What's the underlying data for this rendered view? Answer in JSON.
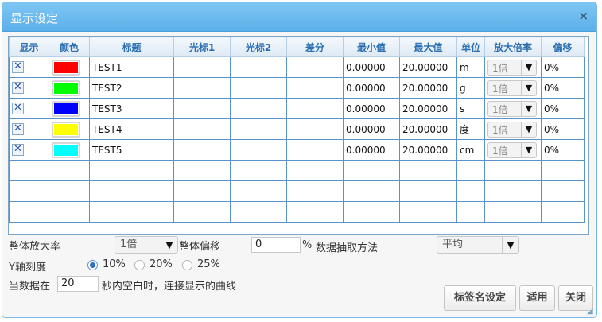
{
  "window": {
    "title": "显示设定",
    "close_symbol": "×"
  },
  "table": {
    "headers": [
      "显示",
      "颜色",
      "标题",
      "光标1",
      "光标2",
      "差分",
      "最小值",
      "最大值",
      "单位",
      "放大倍率",
      "偏移"
    ],
    "rows": [
      {
        "checked": true,
        "color": "#ff0000",
        "title": "TEST1",
        "cursor1": "",
        "cursor2": "",
        "diff": "",
        "min": "0.00000",
        "max": "20.00000",
        "unit": "m",
        "zoom": "1倍",
        "offset": "0%"
      },
      {
        "checked": true,
        "color": "#00ff00",
        "title": "TEST2",
        "cursor1": "",
        "cursor2": "",
        "diff": "",
        "min": "0.00000",
        "max": "20.00000",
        "unit": "g",
        "zoom": "1倍",
        "offset": "0%"
      },
      {
        "checked": true,
        "color": "#0000ff",
        "title": "TEST3",
        "cursor1": "",
        "cursor2": "",
        "diff": "",
        "min": "0.00000",
        "max": "20.00000",
        "unit": "s",
        "zoom": "1倍",
        "offset": "0%"
      },
      {
        "checked": true,
        "color": "#ffff00",
        "title": "TEST4",
        "cursor1": "",
        "cursor2": "",
        "diff": "",
        "min": "0.00000",
        "max": "20.00000",
        "unit": "度",
        "zoom": "1倍",
        "offset": "0%"
      },
      {
        "checked": true,
        "color": "#00ffff",
        "title": "TEST5",
        "cursor1": "",
        "cursor2": "",
        "diff": "",
        "min": "0.00000",
        "max": "20.00000",
        "unit": "cm",
        "zoom": "1倍",
        "offset": "0%"
      }
    ],
    "empty_row_count": 3
  },
  "settings": {
    "overall_zoom_label": "整体放大率",
    "overall_zoom_value": "1倍",
    "overall_offset_label": "整体偏移",
    "overall_offset_value": "0",
    "percent_sign": "%",
    "sampling_label": "数据抽取方法",
    "sampling_value": "平均",
    "y_axis_label": "Y轴刻度",
    "y_options": [
      "10%",
      "20%",
      "25%"
    ],
    "y_selected": "10%",
    "blank_prefix": "当数据在",
    "blank_seconds": "20",
    "blank_suffix": "秒内空白时，连接显示的曲线"
  },
  "buttons": {
    "tag_names": "标签名设定",
    "apply": "适用",
    "close": "关闭"
  },
  "icons": {
    "checkbox": "x-checkbox-icon",
    "dropdown": "triangle-down-icon",
    "close": "close-icon",
    "resize": "resize-grip-icon"
  },
  "colors": {
    "title_bar": "#5cb0ea",
    "header_text": "#2b6fb0",
    "grid_line": "#5a93c9"
  }
}
